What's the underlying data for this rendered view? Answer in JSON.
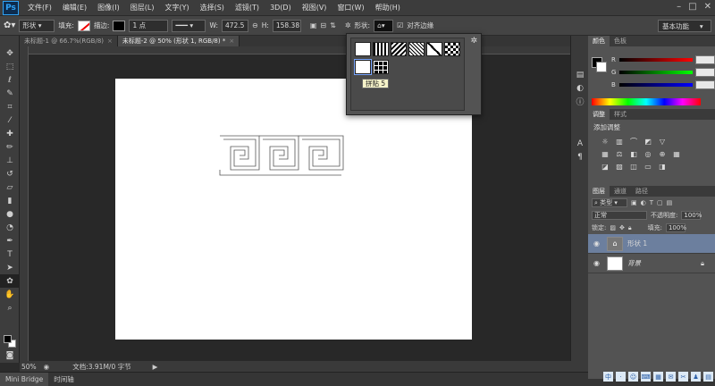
{
  "app": {
    "logo": "Ps",
    "menu": [
      "文件(F)",
      "编辑(E)",
      "图像(I)",
      "图层(L)",
      "文字(Y)",
      "选择(S)",
      "滤镜(T)",
      "3D(D)",
      "视图(V)",
      "窗口(W)",
      "帮助(H)"
    ]
  },
  "options": {
    "tool_mode": "形状",
    "fill_label": "填充:",
    "stroke_label": "描边:",
    "stroke_width": "1 点",
    "w_label": "W:",
    "w_value": "472.5",
    "h_label": "H:",
    "h_value": "158.38",
    "shape_label": "形状:",
    "align_edges_label": "对齐边缘",
    "workspace": "基本功能"
  },
  "tabs": [
    {
      "label": "未标题-1 @ 66.7%(RGB/8)",
      "active": false
    },
    {
      "label": "未标题-2 @ 50% (形状 1, RGB/8) *",
      "active": true
    }
  ],
  "picker": {
    "tooltip": "拼贴 5"
  },
  "status": {
    "zoom": "50%",
    "doc": "文档:3.91M/0 字节"
  },
  "bottom_tabs": [
    "Mini Bridge",
    "时间轴"
  ],
  "color_panel": {
    "tabs": [
      "颜色",
      "色板"
    ],
    "channels": [
      "R",
      "G",
      "B"
    ]
  },
  "adjust_panel": {
    "tabs": [
      "调整",
      "样式"
    ],
    "title": "添加调整"
  },
  "layers_panel": {
    "tabs": [
      "图层",
      "通道",
      "路径"
    ],
    "kind_label": "类型",
    "blend_mode": "正常",
    "opacity_label": "不透明度:",
    "opacity": "100%",
    "lock_label": "锁定:",
    "fill_label": "填充:",
    "fill": "100%",
    "layers": [
      {
        "name": "形状 1",
        "selected": true
      },
      {
        "name": "背景",
        "selected": false
      }
    ]
  },
  "taskbar": [
    "中",
    "·",
    "☺",
    "⌨",
    "▦",
    "✉",
    "✂",
    "♟",
    "▤"
  ]
}
